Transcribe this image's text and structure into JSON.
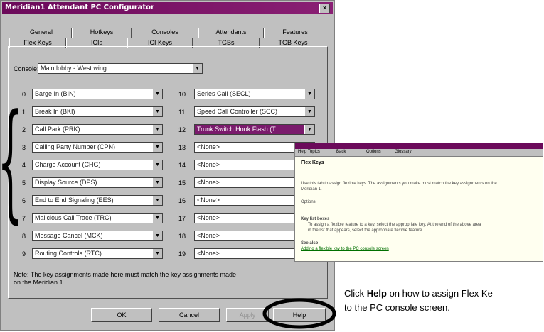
{
  "window": {
    "title": "Meridian1 Attendant PC Configurator",
    "close": "×"
  },
  "tabs_back": [
    "General",
    "Hotkeys",
    "Consoles",
    "Attendants",
    "Features"
  ],
  "tabs_front": [
    "Flex Keys",
    "ICIs",
    "ICI Keys",
    "TGBs",
    "TGB Keys"
  ],
  "console": {
    "label": "Console:",
    "value": "Main lobby - West wing"
  },
  "brace": "{",
  "keys_left": [
    {
      "num": "0",
      "value": "Barge In (BIN)"
    },
    {
      "num": "1",
      "value": "Break In (BKI)"
    },
    {
      "num": "2",
      "value": "Call Park (PRK)"
    },
    {
      "num": "3",
      "value": "Calling Party Number (CPN)"
    },
    {
      "num": "4",
      "value": "Charge Account (CHG)"
    },
    {
      "num": "5",
      "value": "Display Source (DPS)"
    },
    {
      "num": "6",
      "value": "End to End Signaling (EES)"
    },
    {
      "num": "7",
      "value": "Malicious Call Trace (TRC)"
    },
    {
      "num": "8",
      "value": "Message Cancel (MCK)"
    },
    {
      "num": "9",
      "value": "Routing Controls (RTC)"
    }
  ],
  "keys_right": [
    {
      "num": "10",
      "value": "Series Call (SECL)"
    },
    {
      "num": "11",
      "value": "Speed Call Controller (SCC)"
    },
    {
      "num": "12",
      "value": "Trunk Switch Hook Flash (T"
    },
    {
      "num": "13",
      "value": "<None>"
    },
    {
      "num": "14",
      "value": "<None>"
    },
    {
      "num": "15",
      "value": "<None>"
    },
    {
      "num": "16",
      "value": "<None>"
    },
    {
      "num": "17",
      "value": "<None>"
    },
    {
      "num": "18",
      "value": "<None>"
    },
    {
      "num": "19",
      "value": "<None>"
    }
  ],
  "note": [
    "Note: The key assignments made here must match the key assignments made",
    "on the Meridian 1."
  ],
  "buttons": {
    "ok": "OK",
    "cancel": "Cancel",
    "apply": "Apply",
    "help": "Help"
  },
  "help_window": {
    "menu": [
      "Help Topics",
      "Back",
      "Options",
      "Glossary"
    ],
    "heading": "Flex Keys",
    "lines": [
      "Use this tab to assign flexible keys. The assignments you make must match the key assignments on the",
      "Meridian 1.",
      "Options",
      "Key list boxes",
      "To assign a flexible feature to a key, select the appropriate key. At the end of the above area",
      "in the list that appears, select the appropriate flexible feature.",
      "See also",
      "Adding a flexible key to the PC console screen"
    ]
  },
  "caption": {
    "prefix": "Click ",
    "bold": "Help",
    "suffix": " on how to assign Flex Ke",
    "line2": "to the PC console screen."
  }
}
